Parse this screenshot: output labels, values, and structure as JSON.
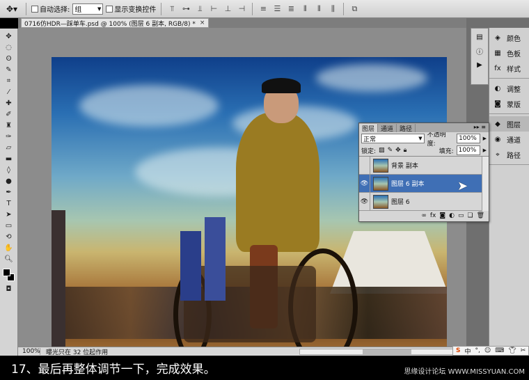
{
  "options_bar": {
    "auto_select_label": "自动选择:",
    "auto_select_value": "组",
    "show_transform_label": "显示变换控件"
  },
  "document": {
    "tab_title": "0716仿HDR—踩单车.psd @ 100% (图层 6 副本, RGB/8) *",
    "close_glyph": "×"
  },
  "status": {
    "zoom": "100%",
    "info": "曝光只在 32 位起作用"
  },
  "dock": {
    "groups": [
      [
        {
          "icon": "color-icon",
          "glyph": "◈",
          "label": "颜色"
        },
        {
          "icon": "swatches-icon",
          "glyph": "▦",
          "label": "色板"
        },
        {
          "icon": "styles-icon",
          "glyph": "fx",
          "label": "样式"
        }
      ],
      [
        {
          "icon": "adjustments-icon",
          "glyph": "◐",
          "label": "调整"
        },
        {
          "icon": "masks-icon",
          "glyph": "◙",
          "label": "蒙版"
        }
      ],
      [
        {
          "icon": "layers-icon",
          "glyph": "◆",
          "label": "图层"
        },
        {
          "icon": "channels-icon",
          "glyph": "◉",
          "label": "通道"
        },
        {
          "icon": "paths-icon",
          "glyph": "⌖",
          "label": "路径"
        }
      ]
    ]
  },
  "layers_panel": {
    "tabs": [
      "图层",
      "通道",
      "路径"
    ],
    "blend_mode": "正常",
    "opacity_label": "不透明度:",
    "opacity_value": "100%",
    "lock_label": "锁定:",
    "fill_label": "填充:",
    "fill_value": "100%",
    "layers": [
      {
        "name": "背景 副本",
        "visible": false,
        "selected": false
      },
      {
        "name": "图层 6 副本",
        "visible": true,
        "selected": true
      },
      {
        "name": "图层 6",
        "visible": true,
        "selected": false
      }
    ]
  },
  "caption": "17、最后再整体调节一下，完成效果。",
  "watermark": "思缘设计论坛  WWW.MISSYUAN.COM",
  "ime": {
    "brand": "S",
    "mode": "中"
  },
  "colors": {
    "selection": "#3f6fb5",
    "panel_bg": "#d6d6d6",
    "workspace": "#8c8c8c"
  }
}
